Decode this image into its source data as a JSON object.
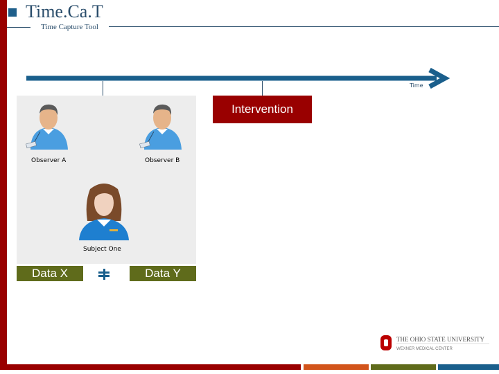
{
  "header": {
    "title": "Time.Ca.T",
    "subtitle": "Time Capture Tool"
  },
  "timeline": {
    "label": "Time",
    "arrow_color": "#1a5f8c"
  },
  "intervention": {
    "label": "Intervention",
    "color": "#990000"
  },
  "people": [
    {
      "label": "Observer A",
      "icon": "observer-icon"
    },
    {
      "label": "Observer B",
      "icon": "observer-icon"
    },
    {
      "label": "Subject One",
      "icon": "subject-icon"
    }
  ],
  "data": {
    "left": "Data X",
    "right": "Data Y",
    "relation": "≠",
    "box_color": "#5f6b1b"
  },
  "logo": {
    "line1": "The Ohio State University",
    "line2": "Wexner Medical Center"
  },
  "footer_colors": [
    "#990000",
    "#d2541b",
    "#5f6b1b",
    "#1a5f8c"
  ]
}
